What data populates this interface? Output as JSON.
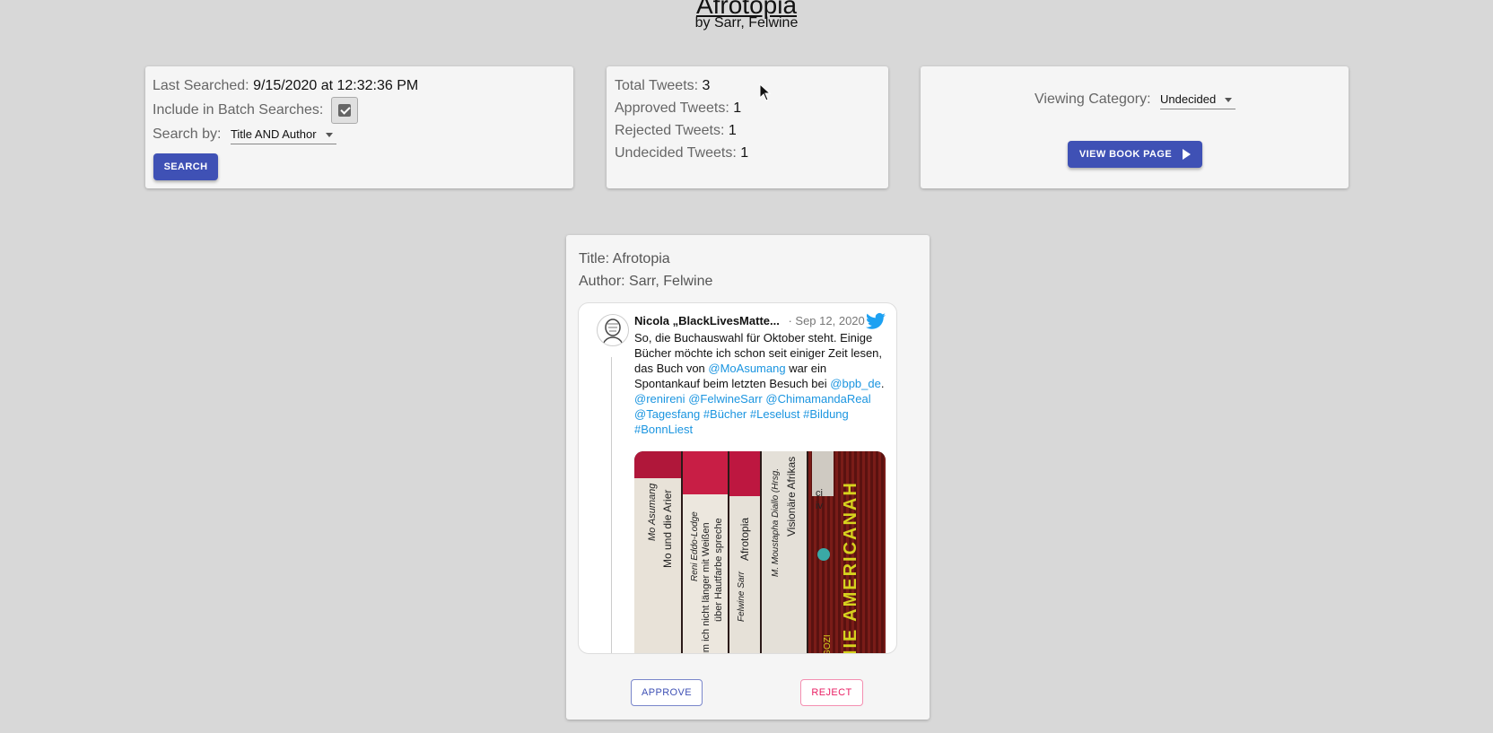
{
  "book": {
    "title": "Afrotopia",
    "byline": "by Sarr, Felwine"
  },
  "search_card": {
    "last_searched_label": "Last Searched:",
    "last_searched_value": "9/15/2020 at 12:32:36 PM",
    "batch_label": "Include in Batch Searches:",
    "batch_checked": true,
    "search_by_label": "Search by:",
    "search_by_value": "Title AND Author",
    "search_button": "SEARCH"
  },
  "stats_card": {
    "total_label": "Total Tweets:",
    "total_value": "3",
    "approved_label": "Approved Tweets:",
    "approved_value": "1",
    "rejected_label": "Rejected Tweets:",
    "rejected_value": "1",
    "undecided_label": "Undecided Tweets:",
    "undecided_value": "1"
  },
  "category_card": {
    "label": "Viewing Category:",
    "value": "Undecided",
    "view_button": "VIEW BOOK PAGE"
  },
  "tweet_card": {
    "title_line": "Title: Afrotopia",
    "author_line": "Author: Sarr, Felwine",
    "tweet": {
      "author": "Nicola „BlackLivesMatte...",
      "date": "· Sep 12, 2020",
      "text_plain_1": "So, die Buchauswahl für Oktober steht. Einige Bücher möchte ich schon seit einiger Zeit lesen, das Buch von ",
      "mention_1": "@MoAsumang",
      "text_plain_2": " war ein Spontankauf beim letzten Besuch bei ",
      "mention_2": "@bpb_de",
      "text_plain_3": ". ",
      "mention_3": "@renireni",
      "mention_4": "@FelwineSarr",
      "mention_5": "@ChimamandaReal",
      "mention_6": "@Tagesfang",
      "hashtag_1": "#Bücher",
      "hashtag_2": "#Leselust",
      "hashtag_3": "#Bildung",
      "hashtag_4": "#BonnLiest",
      "spines": {
        "spine_1_author": "Mo Asumang",
        "spine_1_title": "Mo und die Arier",
        "spine_2_author": "Reni Eddo-Lodge",
        "spine_2_title_a": "arum ich nicht länger mit Weißen",
        "spine_2_title_b": "über Hautfarbe spreche",
        "spine_3_author": "Felwine Sarr",
        "spine_3_title": "Afrotopia",
        "spine_4_author": "M. Moustapha Diallo (Hrsg.",
        "spine_4_title": "Visionäre Afrikas",
        "spine_5_title": "HIE AMERICANAH",
        "spine_5_author": "NGOZI",
        "spine_6_text": "ciiv"
      }
    },
    "approve_button": "APPROVE",
    "reject_button": "REJECT"
  },
  "colors": {
    "primary": "#3f51b5",
    "reject": "#e91e63",
    "link": "#1b95e0",
    "twitter": "#1da1f2"
  }
}
